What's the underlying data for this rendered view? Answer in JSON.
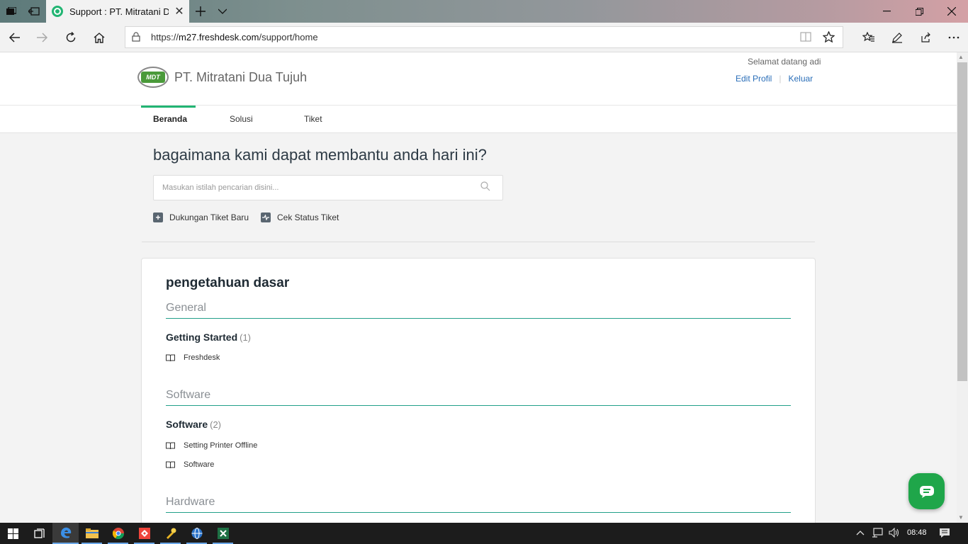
{
  "browser": {
    "tab_title": "Support : PT. Mitratani D",
    "url_prefix": "https://",
    "url_host": "m27.freshdesk.com",
    "url_path": "/support/home"
  },
  "header": {
    "brand": "PT. Mitratani Dua Tujuh",
    "logo_text": "MDT",
    "welcome": "Selamat datang adi",
    "edit_profile": "Edit Profil",
    "logout": "Keluar"
  },
  "nav": {
    "items": [
      {
        "label": "Beranda",
        "active": true
      },
      {
        "label": "Solusi",
        "active": false
      },
      {
        "label": "Tiket",
        "active": false
      }
    ]
  },
  "hero": {
    "title": "bagaimana kami dapat membantu anda hari ini?",
    "search_placeholder": "Masukan istilah pencarian disini...",
    "new_ticket": "Dukungan Tiket Baru",
    "check_status": "Cek Status Tiket"
  },
  "kb": {
    "title": "pengetahuan dasar",
    "categories": [
      {
        "name": "General",
        "folders": [
          {
            "name": "Getting Started",
            "count": "(1)",
            "articles": [
              "Freshdesk"
            ]
          }
        ]
      },
      {
        "name": "Software",
        "folders": [
          {
            "name": "Software",
            "count": "(2)",
            "articles": [
              "Setting Printer Offline",
              "Software"
            ]
          }
        ]
      },
      {
        "name": "Hardware",
        "folders": []
      }
    ]
  },
  "taskbar": {
    "time": "08:48"
  },
  "colors": {
    "accent": "#22b573",
    "link": "#2a6eb8",
    "chat": "#1fa64a"
  }
}
